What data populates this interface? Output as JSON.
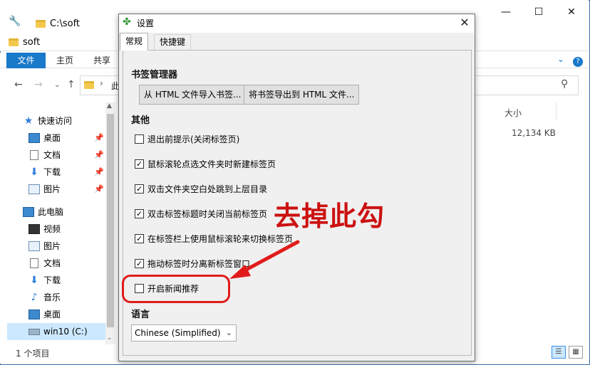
{
  "explorer": {
    "window_controls": {
      "minimize": "—",
      "maximize": "☐",
      "close": "✕"
    },
    "tab_path": "C:\\soft",
    "sub_tab": "soft",
    "ribbon": {
      "file": "文件",
      "home": "主页",
      "share": "共享",
      "help": "?"
    },
    "nav": {
      "back": "←",
      "forward": "→",
      "recent": "⌄",
      "up": "↑"
    },
    "address_visible": "此",
    "address_chevron": "›",
    "nav_pane": {
      "quick_access": "快速访问",
      "items_quick": [
        "桌面",
        "文档",
        "下载",
        "图片"
      ],
      "pin_glyph": "📌",
      "this_pc": "此电脑",
      "items_pc": [
        "视频",
        "图片",
        "文档",
        "下载",
        "音乐",
        "桌面",
        "win10 (C:)"
      ]
    },
    "columns": {
      "size": "大小"
    },
    "rows": [
      {
        "size": "12,134 KB"
      }
    ],
    "status": "1 个项目"
  },
  "dialog": {
    "title": "设置",
    "close": "✕",
    "tabs": [
      "常规",
      "快捷键"
    ],
    "bookmark_manager": {
      "heading": "书签管理器",
      "import_btn": "从 HTML 文件导入书签...",
      "export_btn": "将书签导出到 HTML 文件..."
    },
    "other": {
      "heading": "其他",
      "options": [
        {
          "label": "退出前提示(关闭标签页)",
          "checked": false
        },
        {
          "label": "鼠标滚轮点选文件夹时新建标签页",
          "checked": true
        },
        {
          "label": "双击文件夹空白处跳到上层目录",
          "checked": true
        },
        {
          "label": "双击标签标题时关闭当前标签页",
          "checked": true
        },
        {
          "label": "在标签栏上使用鼠标滚轮来切换标签页",
          "checked": true
        },
        {
          "label": "拖动标签时分离新标签窗口",
          "checked": true
        },
        {
          "label": "开启新闻推荐",
          "checked": false
        }
      ]
    },
    "language": {
      "heading": "语言",
      "selected": "Chinese (Simplified)"
    }
  },
  "annotation": {
    "text": "去掉此勾",
    "color": "#cc1111"
  },
  "colors": {
    "ribbon_accent": "#1979ca",
    "selection": "#cce8ff",
    "annotation_red": "#e21b1b"
  }
}
